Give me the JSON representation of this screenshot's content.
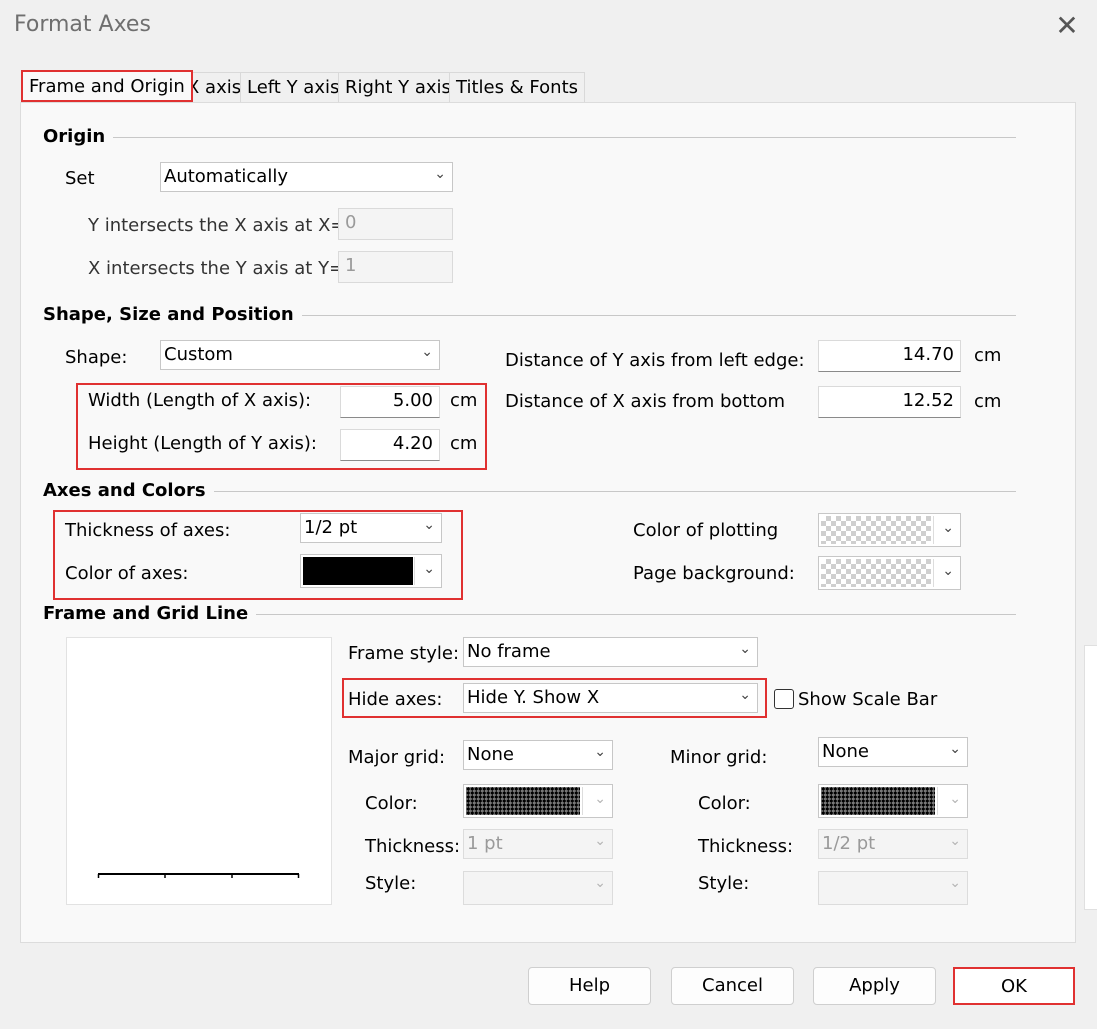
{
  "window": {
    "title": "Format Axes",
    "close_glyph": "✕"
  },
  "tabs": [
    {
      "label": "Frame and Origin",
      "active": true
    },
    {
      "label": "X axis"
    },
    {
      "label": "Left Y axis"
    },
    {
      "label": "Right Y axis"
    },
    {
      "label": "Titles & Fonts"
    }
  ],
  "origin": {
    "title": "Origin",
    "set_label": "Set",
    "set_value": "Automatically",
    "y_intersect_label": "Y intersects the X axis at X=",
    "y_intersect_value": "0",
    "x_intersect_label": "X intersects the Y axis at Y=",
    "x_intersect_value": "1"
  },
  "shape": {
    "title": "Shape, Size and Position",
    "shape_label": "Shape:",
    "shape_value": "Custom",
    "width_label": "Width (Length of X axis):",
    "width_value": "5.00",
    "height_label": "Height (Length of Y axis):",
    "height_value": "4.20",
    "unit": "cm",
    "dist_y_label": "Distance of Y axis from left edge:",
    "dist_y_value": "14.70",
    "dist_x_label": "Distance of X axis from bottom",
    "dist_x_value": "12.52"
  },
  "axes_colors": {
    "title": "Axes and Colors",
    "thickness_label": "Thickness of axes:",
    "thickness_value": "1/2 pt",
    "color_label": "Color of axes:",
    "color_value": "#000000",
    "plotting_label": "Color of plotting",
    "background_label": "Page background:"
  },
  "frame_grid": {
    "title": "Frame and Grid Line",
    "frame_style_label": "Frame style:",
    "frame_style_value": "No frame",
    "hide_axes_label": "Hide axes:",
    "hide_axes_value": "Hide Y. Show X",
    "scale_bar_label": "Show Scale Bar",
    "scale_bar_checked": false,
    "major_grid_label": "Major grid:",
    "major_grid_value": "None",
    "minor_grid_label": "Minor grid:",
    "minor_grid_value": "None",
    "color_label": "Color:",
    "thickness_label": "Thickness:",
    "style_label": "Style:",
    "major_thickness_value": "1 pt",
    "minor_thickness_value": "1/2 pt"
  },
  "buttons": {
    "help": "Help",
    "cancel": "Cancel",
    "apply": "Apply",
    "ok": "OK"
  },
  "colors": {
    "highlight": "#e03131",
    "axis_color": "#000000"
  }
}
